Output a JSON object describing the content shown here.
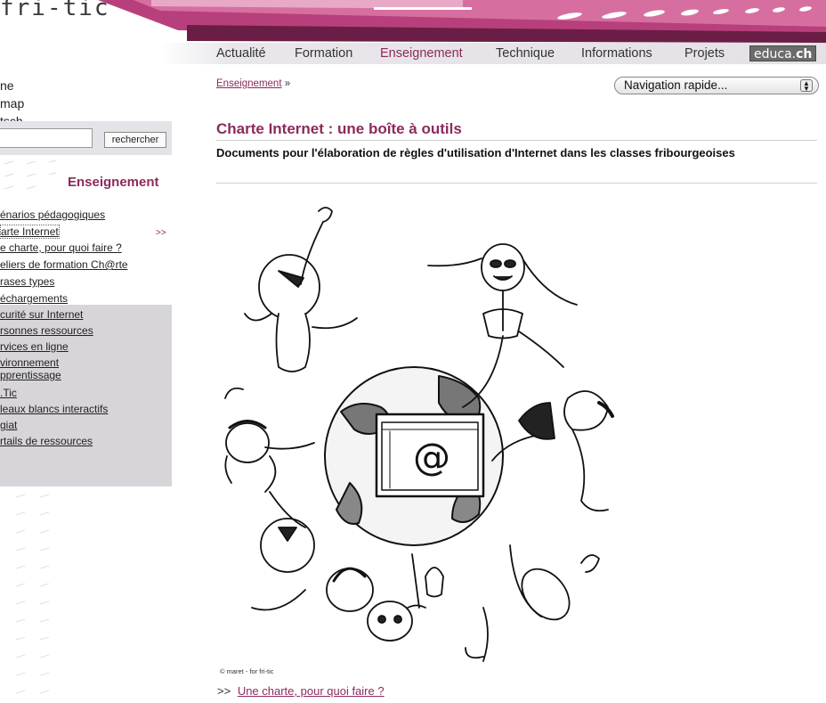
{
  "header": {
    "logo": "fri-tic",
    "colors": {
      "brand": "#8c2a5d"
    }
  },
  "topnav": {
    "items": [
      "Actualité",
      "Formation",
      "Enseignement",
      "Technique",
      "Informations",
      "Projets"
    ],
    "active": "Enseignement",
    "educa": {
      "part1": "educa.",
      "part2": "ch"
    }
  },
  "sidebar": {
    "top_links": [
      "ne",
      "map",
      "tsch"
    ],
    "search": {
      "value": "",
      "button": "rechercher"
    },
    "section_title": "Enseignement",
    "menu": [
      "énarios pédagogiques",
      "arte Internet",
      "e charte, pour quoi faire ?",
      "eliers de formation Ch@rte",
      "rases types",
      "échargements"
    ],
    "current_marker": ">>",
    "submenu": [
      "curité sur Internet",
      "rsonnes ressources",
      "rvices en ligne",
      "vironnement\npprentissage",
      ".Tic",
      "leaux blancs interactifs",
      "giat",
      "rtails de ressources"
    ]
  },
  "main": {
    "breadcrumb": {
      "link": "Enseignement",
      "sep": "»"
    },
    "quicknav": "Navigation rapide...",
    "title": "Charte Internet : une boîte à outils",
    "subtitle": "Documents pour l'élaboration de règles d'utilisation d'Internet dans les classes fribourgeoises",
    "illustration_center": "@",
    "credit": "© maret - for fri-tic",
    "more_prefix": ">>",
    "more_link": "Une charte, pour quoi faire ?"
  }
}
